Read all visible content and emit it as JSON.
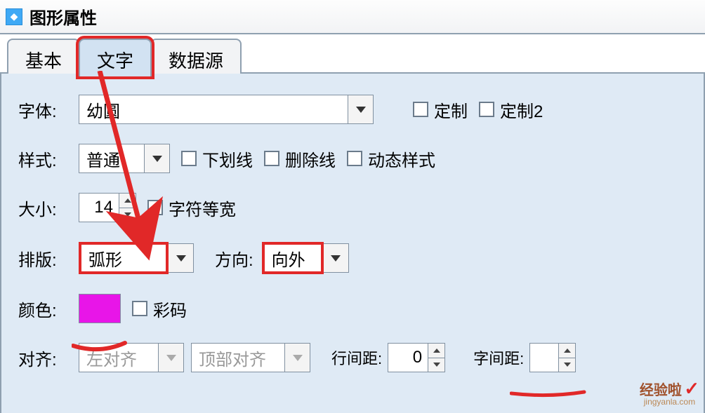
{
  "window": {
    "title": "图形属性"
  },
  "tabs": [
    {
      "label": "基本"
    },
    {
      "label": "文字",
      "active": true
    },
    {
      "label": "数据源"
    }
  ],
  "font": {
    "label": "字体:",
    "value": "幼圆",
    "custom1": "定制",
    "custom2": "定制2"
  },
  "style": {
    "label": "样式:",
    "value": "普通",
    "underline": "下划线",
    "strikeout": "删除线",
    "dynamic": "动态样式"
  },
  "size": {
    "label": "大小:",
    "value": "14",
    "monowidth": "字符等宽"
  },
  "layout": {
    "label": "排版:",
    "value": "弧形",
    "dirLabel": "方向:",
    "dirValue": "向外"
  },
  "color": {
    "label": "颜色:",
    "colorcode": "彩码",
    "hex": "#e815e8"
  },
  "align": {
    "label": "对齐:",
    "h": "左对齐",
    "v": "顶部对齐",
    "lineSpacingLabel": "行间距:",
    "lineSpacingValue": "0",
    "charSpacingLabel": "字间距:",
    "charSpacingValue": ""
  },
  "watermark": {
    "text1": "经验啦",
    "text2": "jingyanla.com"
  }
}
